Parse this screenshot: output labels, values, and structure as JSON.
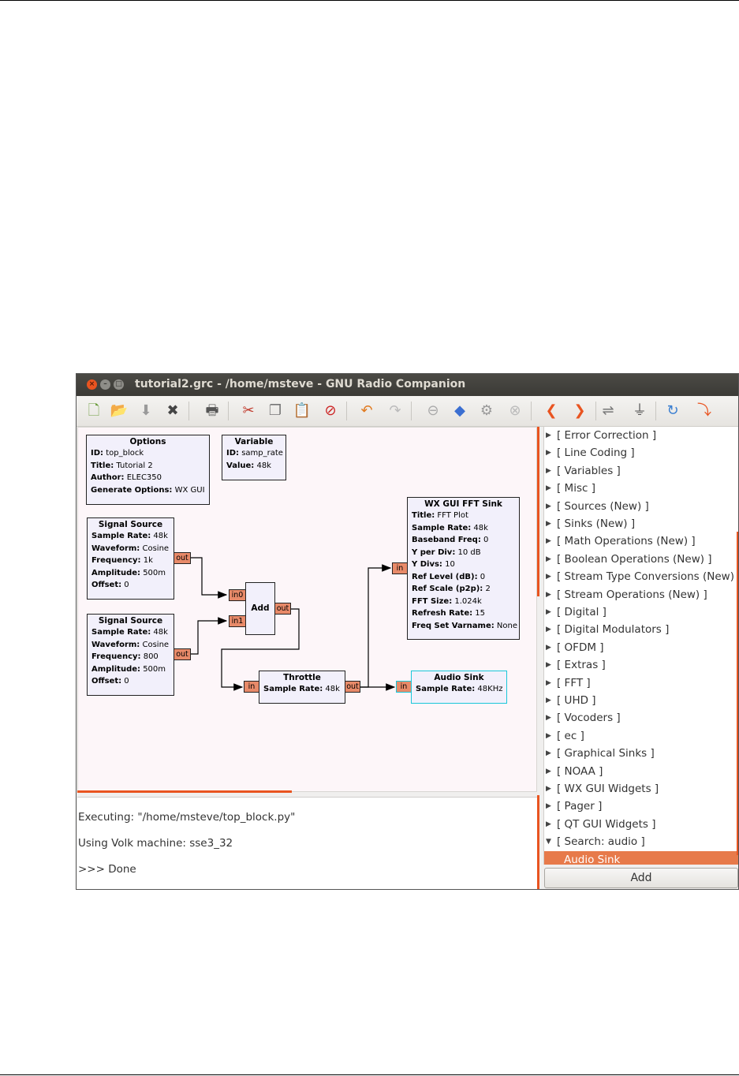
{
  "window": {
    "title": "tutorial2.grc - /home/msteve - GNU Radio Companion",
    "controls": {
      "close": "×",
      "minimize": "–",
      "maximize": "□"
    }
  },
  "toolbar": [
    {
      "name": "new-icon",
      "glyph": "🗋",
      "color": "#6a9b3a"
    },
    {
      "name": "open-icon",
      "glyph": "📂",
      "color": "#e07a1f"
    },
    {
      "name": "save-icon",
      "glyph": "⬇",
      "color": "#9a9a9a"
    },
    {
      "name": "close-file-icon",
      "glyph": "✖",
      "color": "#444444"
    },
    {
      "name": "print-icon",
      "glyph": "🖶",
      "color": "#555555"
    },
    {
      "name": "cut-icon",
      "glyph": "✂",
      "color": "#c0392b"
    },
    {
      "name": "copy-icon",
      "glyph": "❐",
      "color": "#777777"
    },
    {
      "name": "paste-icon",
      "glyph": "📋",
      "color": "#999999"
    },
    {
      "name": "delete-icon",
      "glyph": "⊘",
      "color": "#cc2222"
    },
    {
      "name": "undo-icon",
      "glyph": "↶",
      "color": "#e07a1f"
    },
    {
      "name": "redo-icon",
      "glyph": "↷",
      "color": "#bbbbbb"
    },
    {
      "name": "disable-icon",
      "glyph": "⊖",
      "color": "#aaaaaa"
    },
    {
      "name": "generate-icon",
      "glyph": "◆",
      "color": "#3b6fd1"
    },
    {
      "name": "execute-icon",
      "glyph": "⚙",
      "color": "#999999"
    },
    {
      "name": "kill-icon",
      "glyph": "⊗",
      "color": "#bbbbbb"
    },
    {
      "name": "rotate-left-icon",
      "glyph": "❮",
      "color": "#e95420"
    },
    {
      "name": "rotate-right-icon",
      "glyph": "❯",
      "color": "#e95420"
    },
    {
      "name": "enable-icon",
      "glyph": "⇌",
      "color": "#777777"
    },
    {
      "name": "bypass-icon",
      "glyph": "⏚",
      "color": "#555555"
    },
    {
      "name": "reload-icon",
      "glyph": "↻",
      "color": "#3b7fd1"
    },
    {
      "name": "find-icon",
      "glyph": "⤵",
      "color": "#e95420"
    }
  ],
  "blocks": {
    "options": {
      "title": "Options",
      "lines": [
        {
          "k": "ID:",
          "v": " top_block"
        },
        {
          "k": "Title:",
          "v": " Tutorial 2"
        },
        {
          "k": "Author:",
          "v": " ELEC350"
        },
        {
          "k": "Generate Options:",
          "v": " WX GUI"
        }
      ]
    },
    "variable": {
      "title": "Variable",
      "lines": [
        {
          "k": "ID:",
          "v": " samp_rate"
        },
        {
          "k": "Value:",
          "v": " 48k"
        }
      ]
    },
    "signal_source_1": {
      "title": "Signal Source",
      "lines": [
        {
          "k": "Sample Rate:",
          "v": " 48k"
        },
        {
          "k": "Waveform:",
          "v": " Cosine"
        },
        {
          "k": "Frequency:",
          "v": " 1k"
        },
        {
          "k": "Amplitude:",
          "v": " 500m"
        },
        {
          "k": "Offset:",
          "v": " 0"
        }
      ],
      "port_out": "out"
    },
    "signal_source_2": {
      "title": "Signal Source",
      "lines": [
        {
          "k": "Sample Rate:",
          "v": " 48k"
        },
        {
          "k": "Waveform:",
          "v": " Cosine"
        },
        {
          "k": "Frequency:",
          "v": " 800"
        },
        {
          "k": "Amplitude:",
          "v": " 500m"
        },
        {
          "k": "Offset:",
          "v": " 0"
        }
      ],
      "port_out": "out"
    },
    "add": {
      "title": "Add",
      "port_in0": "in0",
      "port_in1": "in1",
      "port_out": "out"
    },
    "throttle": {
      "title": "Throttle",
      "lines": [
        {
          "k": "Sample Rate:",
          "v": " 48k"
        }
      ],
      "port_in": "in",
      "port_out": "out"
    },
    "fft_sink": {
      "title": "WX GUI FFT Sink",
      "lines": [
        {
          "k": "Title:",
          "v": " FFT Plot"
        },
        {
          "k": "Sample Rate:",
          "v": " 48k"
        },
        {
          "k": "Baseband Freq:",
          "v": " 0"
        },
        {
          "k": "Y per Div:",
          "v": " 10 dB"
        },
        {
          "k": "Y Divs:",
          "v": " 10"
        },
        {
          "k": "Ref Level (dB):",
          "v": " 0"
        },
        {
          "k": "Ref Scale (p2p):",
          "v": " 2"
        },
        {
          "k": "FFT Size:",
          "v": " 1.024k"
        },
        {
          "k": "Refresh Rate:",
          "v": " 15"
        },
        {
          "k": "Freq Set Varname:",
          "v": " None"
        }
      ],
      "port_in": "in"
    },
    "audio_sink": {
      "title": "Audio Sink",
      "lines": [
        {
          "k": "Sample Rate:",
          "v": " 48KHz"
        }
      ],
      "port_in": "in"
    }
  },
  "console": [
    "Executing: \"/home/msteve/top_block.py\"",
    "Using Volk machine: sse3_32",
    ">>> Done"
  ],
  "tree": {
    "items": [
      "[ Error Correction ]",
      "[ Line Coding ]",
      "[ Variables ]",
      "[ Misc ]",
      "[ Sources (New) ]",
      "[ Sinks (New) ]",
      "[ Math Operations (New)  ]",
      "[ Boolean Operations (New)  ]",
      "[ Stream Type Conversions (New)  ]",
      "[ Stream Operations (New)  ]",
      "[ Digital ]",
      "[ Digital Modulators ]",
      "[ OFDM ]",
      "[ Extras ]",
      "[ FFT ]",
      "[ UHD ]",
      "[ Vocoders ]",
      "[ ec ]",
      "[ Graphical Sinks ]",
      "[ NOAA ]",
      "[ WX GUI Widgets ]",
      "[ Pager ]",
      "[ QT GUI Widgets ]",
      "[ Search: audio ]"
    ],
    "expanded_index": 23,
    "selected_child": "Audio Sink",
    "arrow_collapsed": "▶",
    "arrow_expanded": "▼"
  },
  "add_button": "Add"
}
